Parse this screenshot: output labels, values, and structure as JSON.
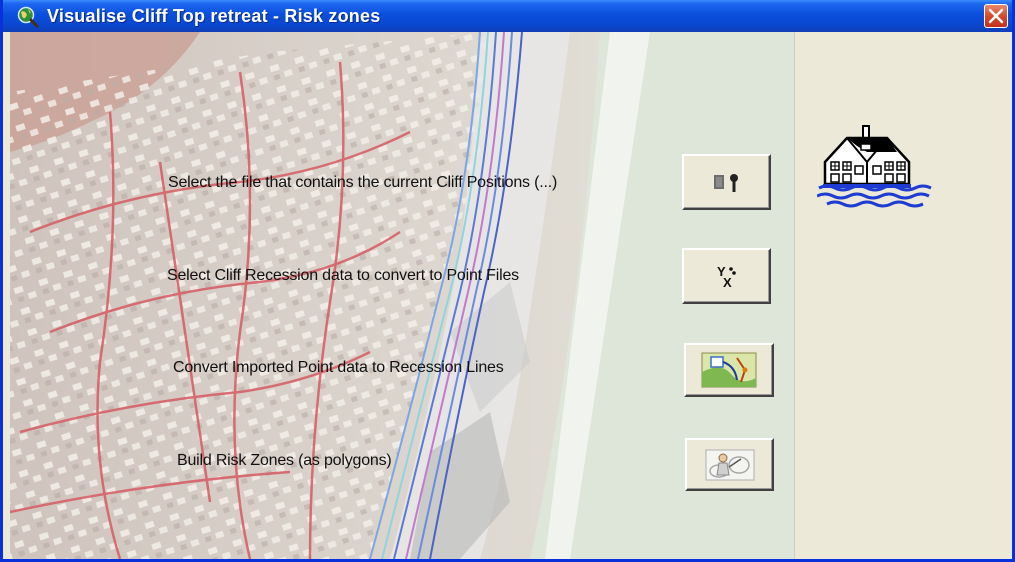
{
  "window": {
    "title": "Visualise Cliff Top retreat - Risk zones",
    "icon": "globe-magnifier-icon",
    "close_icon": "close-icon"
  },
  "rows": [
    {
      "label": "Select the file that contains the current Cliff Positions (...)",
      "button_icon": "add-shapefile-icon"
    },
    {
      "label": "Select Cliff Recession data to convert to Point Files",
      "button_icon": "xy-points-icon"
    },
    {
      "label": "Convert Imported Point data to Recession Lines",
      "button_icon": "convert-lines-icon"
    },
    {
      "label": "Build Risk Zones (as polygons)",
      "button_icon": "build-zones-icon"
    }
  ],
  "logo": "house-on-water-logo",
  "colors": {
    "titlebar": "#0a4fdc",
    "window_bg": "#ece9d8",
    "close": "#d4462a",
    "water": "#1e3cd4"
  }
}
